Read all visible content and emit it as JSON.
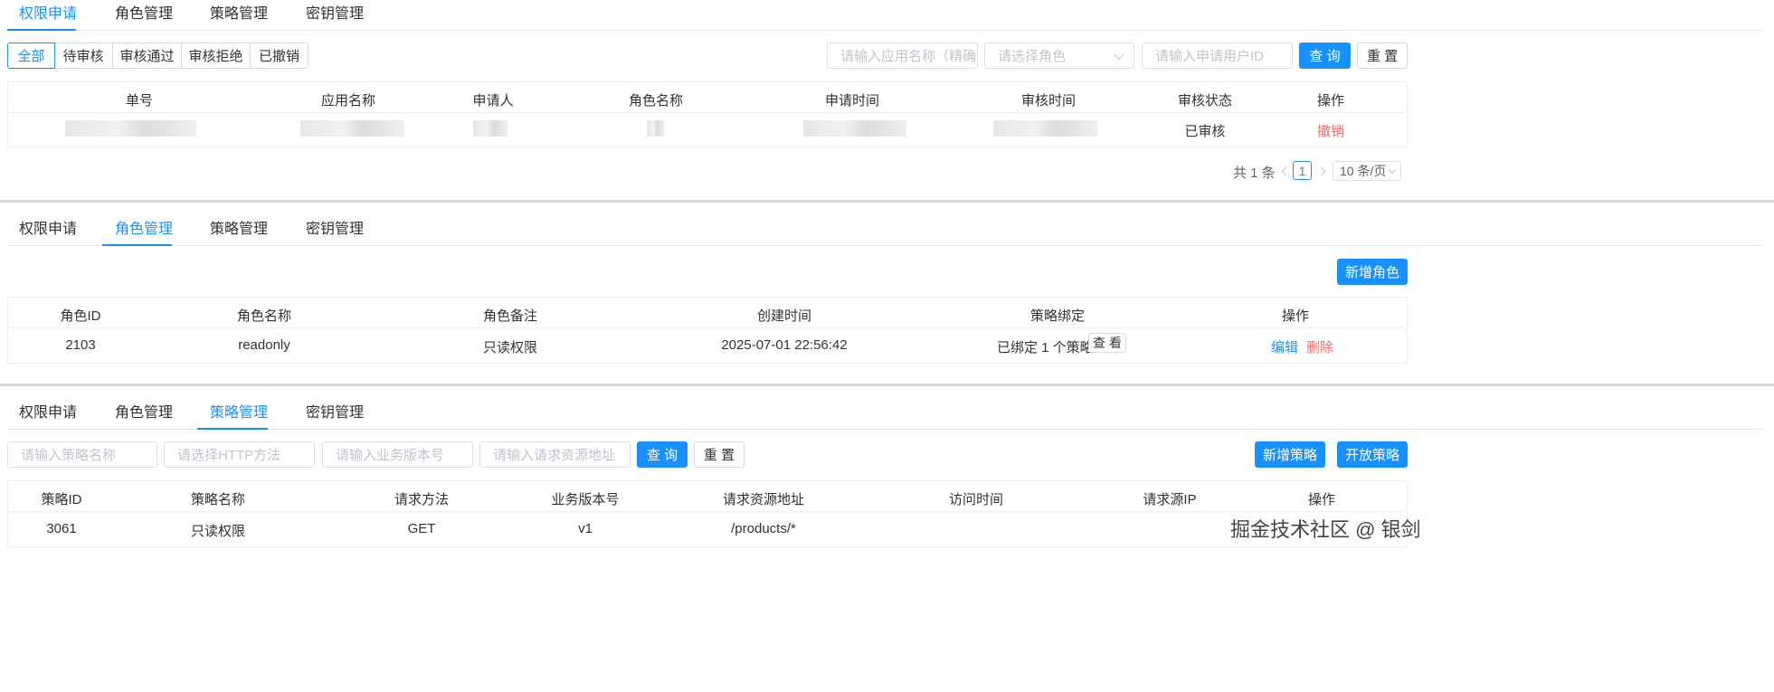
{
  "tabs": [
    "权限申请",
    "角色管理",
    "策略管理",
    "密钥管理"
  ],
  "panel1": {
    "filters": [
      "全部",
      "待审核",
      "审核通过",
      "审核拒绝",
      "已撤销"
    ],
    "app_name_placeholder": "请输入应用名称（精确）",
    "role_placeholder": "请选择角色",
    "user_id_placeholder": "请输入申请用户ID",
    "query_label": "查 询",
    "reset_label": "重 置",
    "columns": [
      "单号",
      "应用名称",
      "申请人",
      "角色名称",
      "申请时间",
      "审核时间",
      "审核状态",
      "操作"
    ],
    "row": {
      "status": "已审核",
      "action": "撤销"
    },
    "pagination": {
      "total": "共 1 条",
      "page": "1",
      "page_size": "10 条/页"
    }
  },
  "panel2": {
    "add_role_label": "新增角色",
    "columns": [
      "角色ID",
      "角色名称",
      "角色备注",
      "创建时间",
      "策略绑定",
      "操作"
    ],
    "row": {
      "id": "2103",
      "name": "readonly",
      "note": "只读权限",
      "created": "2025-07-01 22:56:42",
      "binding": "已绑定 1 个策略",
      "view": "查 看",
      "edit": "编辑",
      "delete": "删除"
    }
  },
  "panel3": {
    "policy_name_placeholder": "请输入策略名称",
    "http_method_placeholder": "请选择HTTP方法",
    "version_placeholder": "请输入业务版本号",
    "resource_placeholder": "请输入请求资源地址",
    "query_label": "查 询",
    "reset_label": "重 置",
    "add_policy_label": "新增策略",
    "open_policy_label": "开放策略",
    "columns": [
      "策略ID",
      "策略名称",
      "请求方法",
      "业务版本号",
      "请求资源地址",
      "访问时间",
      "请求源IP",
      "操作"
    ],
    "row": {
      "id": "3061",
      "name": "只读权限",
      "method": "GET",
      "version": "v1",
      "resource": "/products/*"
    }
  },
  "watermark": "掘金技术社区 @ 银剑"
}
